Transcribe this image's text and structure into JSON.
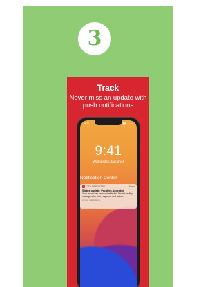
{
  "step": {
    "number": "3"
  },
  "card": {
    "title": "Track",
    "subtitle_line1": "Never miss an update with",
    "subtitle_line2": "push notifications"
  },
  "phone": {
    "status_time": "9:41",
    "status_icons": "▮▮ ◔ ▭",
    "lock_time": "9:41",
    "lock_date": "Wednesday, January 4",
    "notification_center": "Notification Center",
    "notification": {
      "app_name": "CITY REPORTER",
      "time": "15 min",
      "title": "Status update: Problem Accepted",
      "body": "Your report has been submitted to District facility managers for their response and action.",
      "more": "2 more notifications"
    }
  },
  "colors": {
    "panel_green": "#8fcc74",
    "card_red": "#d7262f"
  }
}
